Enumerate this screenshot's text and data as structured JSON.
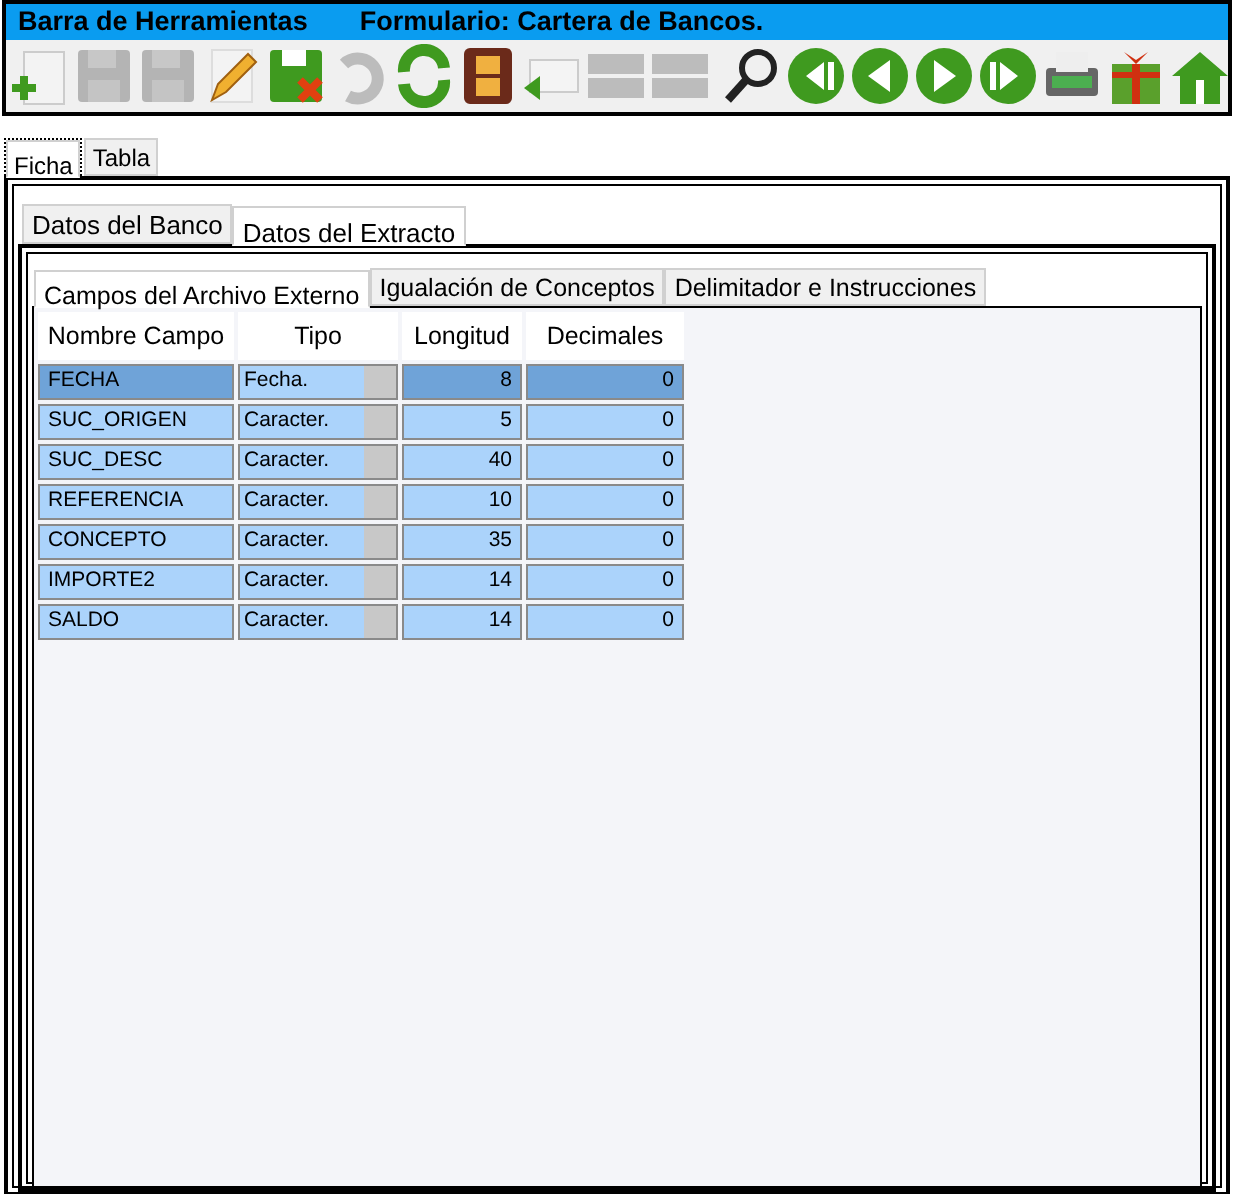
{
  "title_bar": {
    "left": "Barra de Herramientas",
    "right": "Formulario: Cartera de Bancos."
  },
  "toolbar": [
    {
      "kind": "new",
      "disabled": false
    },
    {
      "kind": "save",
      "disabled": true
    },
    {
      "kind": "save",
      "disabled": true
    },
    {
      "kind": "pencil",
      "disabled": false
    },
    {
      "kind": "save-x",
      "disabled": false
    },
    {
      "kind": "undo",
      "disabled": true
    },
    {
      "kind": "refresh",
      "disabled": false
    },
    {
      "kind": "film",
      "disabled": false
    },
    {
      "kind": "mail",
      "disabled": false
    },
    {
      "kind": "bars",
      "disabled": true
    },
    {
      "kind": "bars",
      "disabled": true
    },
    {
      "kind": "search",
      "disabled": false
    },
    {
      "kind": "first",
      "disabled": false
    },
    {
      "kind": "prev",
      "disabled": false
    },
    {
      "kind": "next",
      "disabled": false
    },
    {
      "kind": "last",
      "disabled": false
    },
    {
      "kind": "printer",
      "disabled": false
    },
    {
      "kind": "gift",
      "disabled": false
    },
    {
      "kind": "home",
      "disabled": false
    }
  ],
  "view_tabs": [
    {
      "label": "Ficha",
      "selected": true
    },
    {
      "label": "Tabla",
      "selected": false
    }
  ],
  "section_tabs": [
    {
      "label": "Datos del Banco",
      "selected": false
    },
    {
      "label": "Datos del Extracto",
      "selected": true
    }
  ],
  "sub_tabs": [
    {
      "label": "Campos del Archivo Externo",
      "selected": true
    },
    {
      "label": "Igualación de Conceptos",
      "selected": false
    },
    {
      "label": "Delimitador e Instrucciones",
      "selected": false
    }
  ],
  "table": {
    "columns": [
      "Nombre Campo",
      "Tipo",
      "Longitud",
      "Decimales"
    ],
    "rows": [
      {
        "name": "FECHA",
        "type": "Fecha.",
        "length": "8",
        "decimals": "0",
        "selected": true
      },
      {
        "name": "SUC_ORIGEN",
        "type": "Caracter.",
        "length": "5",
        "decimals": "0",
        "selected": false
      },
      {
        "name": "SUC_DESC",
        "type": "Caracter.",
        "length": "40",
        "decimals": "0",
        "selected": false
      },
      {
        "name": "REFERENCIA",
        "type": "Caracter.",
        "length": "10",
        "decimals": "0",
        "selected": false
      },
      {
        "name": "CONCEPTO",
        "type": "Caracter.",
        "length": "35",
        "decimals": "0",
        "selected": false
      },
      {
        "name": "IMPORTE2",
        "type": "Caracter.",
        "length": "14",
        "decimals": "0",
        "selected": false
      },
      {
        "name": "SALDO",
        "type": "Caracter.",
        "length": "14",
        "decimals": "0",
        "selected": false
      }
    ]
  }
}
